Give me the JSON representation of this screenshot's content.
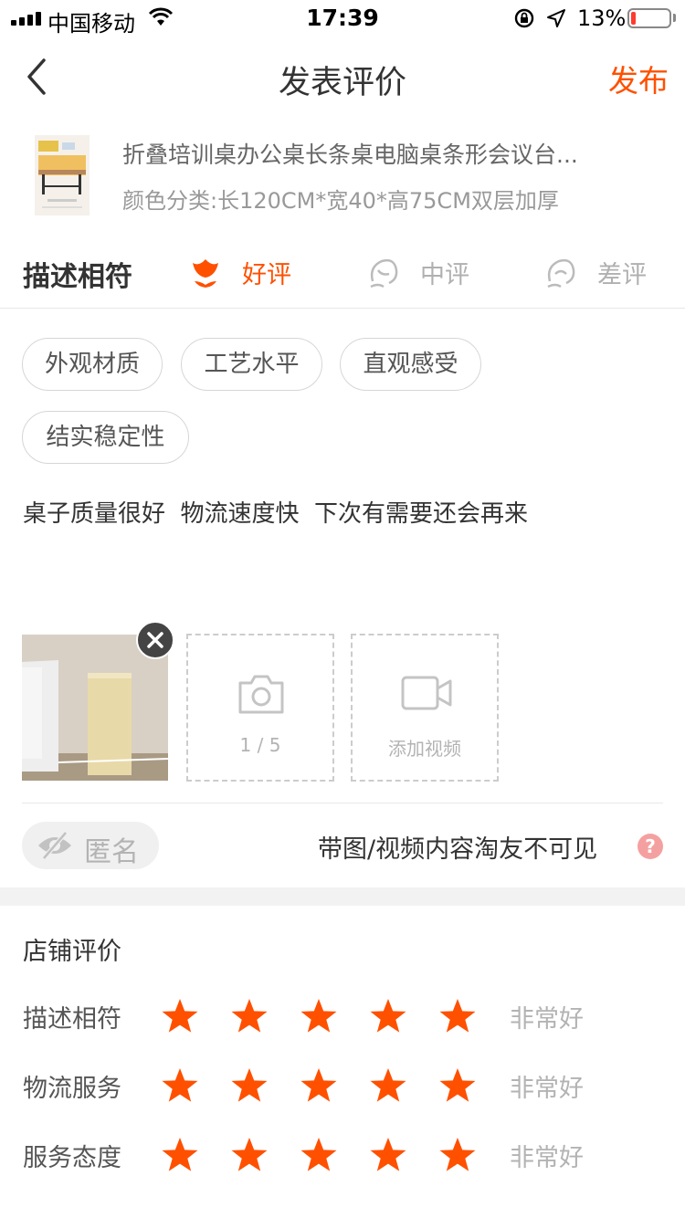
{
  "status_bar": {
    "carrier": "中国移动",
    "time": "17:39",
    "battery_percent": "13%",
    "battery_level": 0.13,
    "battery_color": "#ff3b30",
    "icons": [
      "signal-icon",
      "wifi-icon",
      "orientation-lock-icon",
      "location-arrow-icon",
      "battery-icon"
    ]
  },
  "nav": {
    "back_icon": "chevron-left-icon",
    "title": "发表评价",
    "publish_label": "发布"
  },
  "product": {
    "name": "折叠培训桌办公桌长条桌电脑桌条形会议台...",
    "spec": "颜色分类:长120CM*宽40*高75CM双层加厚"
  },
  "rating": {
    "label": "描述相符",
    "options": [
      {
        "label": "好评",
        "icon": "flower-good-icon",
        "selected": true
      },
      {
        "label": "中评",
        "icon": "face-neutral-icon",
        "selected": false
      },
      {
        "label": "差评",
        "icon": "face-bad-icon",
        "selected": false
      }
    ],
    "accent_color": "#ff5000"
  },
  "tags": [
    "外观材质",
    "工艺水平",
    "直观感受",
    "结实稳定性"
  ],
  "review_text": "桌子质量很好  物流速度快  下次有需要还会再来",
  "media": {
    "photo_upload_count": "1 / 5",
    "add_video_label": "添加视频",
    "remove_icon": "close-circle-icon",
    "photo_icon": "camera-icon",
    "video_icon": "video-camera-icon"
  },
  "anonymous": {
    "label": "匿名",
    "icon": "eye-off-icon"
  },
  "notice": "带图/视频内容淘友不可见",
  "help_icon": "question-circle-icon",
  "shop_review": {
    "title": "店铺评价",
    "rows": [
      {
        "label": "描述相符",
        "stars": 5,
        "max": 5,
        "verdict": "非常好"
      },
      {
        "label": "物流服务",
        "stars": 5,
        "max": 5,
        "verdict": "非常好"
      },
      {
        "label": "服务态度",
        "stars": 5,
        "max": 5,
        "verdict": "非常好"
      }
    ],
    "star_color": "#ff5000"
  }
}
